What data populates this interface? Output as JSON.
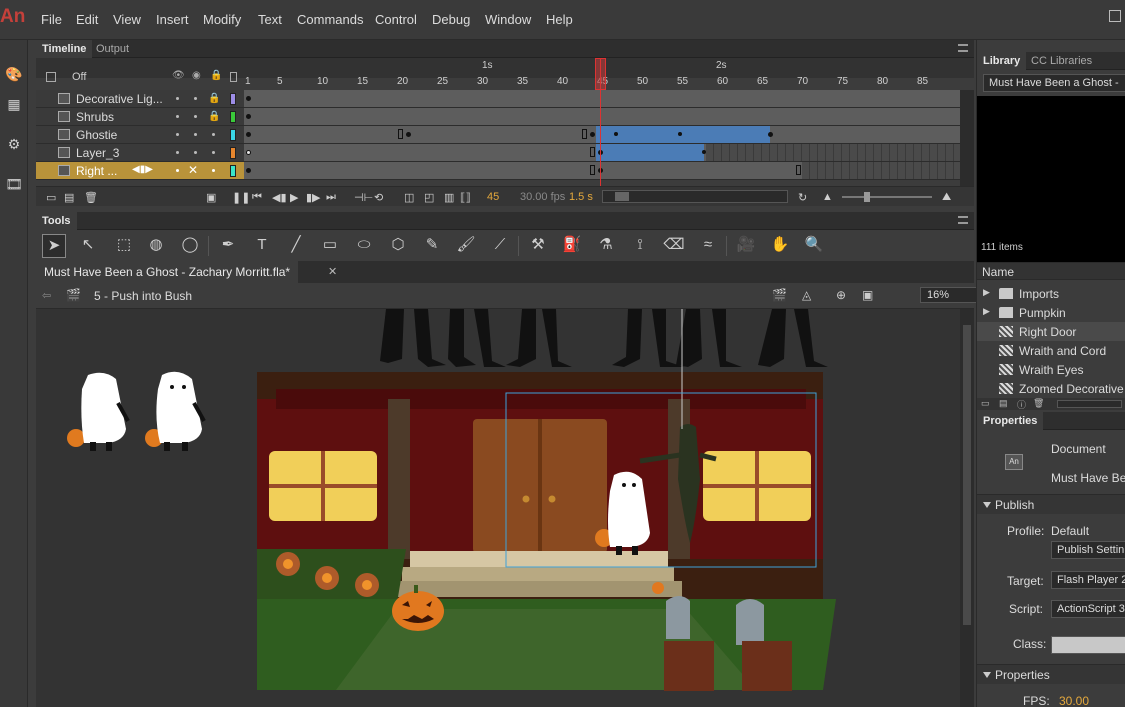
{
  "app": {
    "logo": "An"
  },
  "menu": [
    "File",
    "Edit",
    "View",
    "Insert",
    "Modify",
    "Text",
    "Commands",
    "Control",
    "Debug",
    "Window",
    "Help"
  ],
  "timeline": {
    "tabs": [
      "Timeline",
      "Output"
    ],
    "onion_skin_label": "Off",
    "ruler_seconds": [
      "1s",
      "2s"
    ],
    "ruler_frames": [
      "1",
      "5",
      "10",
      "15",
      "20",
      "25",
      "30",
      "35",
      "40",
      "45",
      "50",
      "55",
      "60",
      "65",
      "70",
      "75",
      "80",
      "85"
    ],
    "layers": [
      {
        "name": "Decorative Lig...",
        "color": "#9d8de6",
        "locked": true
      },
      {
        "name": "Shrubs",
        "color": "#3ac93a",
        "locked": true
      },
      {
        "name": "Ghostie",
        "color": "#3ad6e6",
        "locked": false
      },
      {
        "name": "Layer_3",
        "color": "#e6862e",
        "locked": false
      },
      {
        "name": "Right ...",
        "color": "#3ae6c9",
        "locked": false,
        "selected": true
      }
    ],
    "current_frame": "45",
    "fps": "30.00 fps",
    "elapsed": "1.5 s"
  },
  "tools": {
    "tab": "Tools"
  },
  "document": {
    "tab_title": "Must Have Been a Ghost - Zachary Morritt.fla*",
    "scene": "5 - Push into Bush",
    "zoom": "16%"
  },
  "library": {
    "tabs": [
      "Library",
      "CC Libraries"
    ],
    "document": "Must Have Been a Ghost -",
    "count": "111 items",
    "column_name": "Name",
    "items": [
      {
        "label": "Imports",
        "type": "folder"
      },
      {
        "label": "Pumpkin",
        "type": "folder"
      },
      {
        "label": "Right Door",
        "type": "symbol",
        "selected": true
      },
      {
        "label": "Wraith and Cord",
        "type": "symbol"
      },
      {
        "label": "Wraith Eyes",
        "type": "symbol"
      },
      {
        "label": "Zoomed Decorative L",
        "type": "symbol"
      }
    ]
  },
  "properties": {
    "tab": "Properties",
    "type": "Document",
    "doc_name": "Must Have Bee",
    "publish_section": "Publish",
    "profile_label": "Profile:",
    "profile_value": "Default",
    "publish_settings_button": "Publish Settin",
    "target_label": "Target:",
    "target_value": "Flash Player 2",
    "script_label": "Script:",
    "script_value": "ActionScript 3",
    "class_label": "Class:",
    "properties_section": "Properties",
    "fps_label": "FPS:",
    "fps_value": "30.00"
  },
  "colors": {
    "accent_playhead": "#d33",
    "tween": "#4b7cb6",
    "selected_layer": "#b9933a",
    "logo": "#c4403a"
  }
}
